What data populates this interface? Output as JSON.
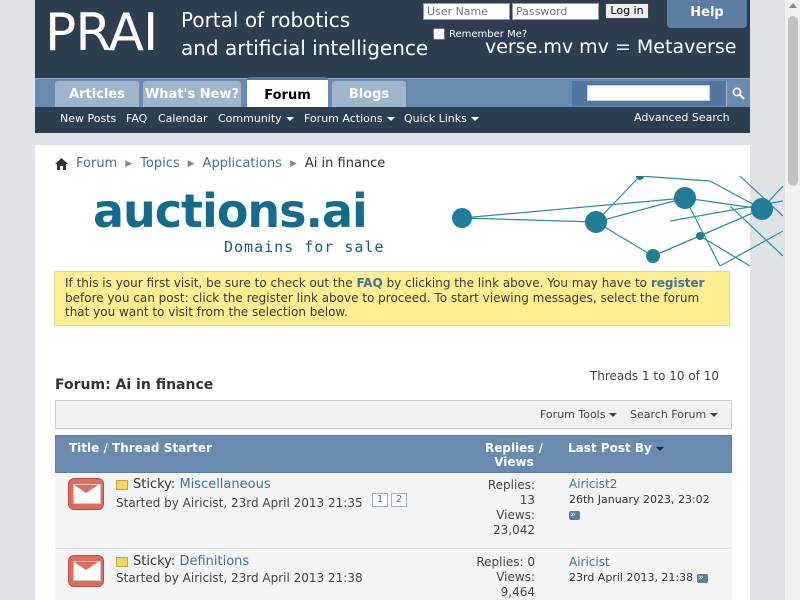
{
  "header": {
    "logo": "PRAI",
    "tagline_line1": "Portal of robotics",
    "tagline_line2": "and artificial intelligence",
    "verse": "verse.mv mv = Metaverse",
    "help": "Help"
  },
  "login": {
    "username_placeholder": "User Name",
    "password_placeholder": "Password",
    "button": "Log in",
    "remember": "Remember Me?"
  },
  "tabs": [
    {
      "label": "Articles"
    },
    {
      "label": "What's New?"
    },
    {
      "label": "Forum"
    },
    {
      "label": "Blogs"
    }
  ],
  "subnav": {
    "new_posts": "New Posts",
    "faq": "FAQ",
    "calendar": "Calendar",
    "community": "Community",
    "forum_actions": "Forum Actions",
    "quick_links": "Quick Links",
    "advanced_search": "Advanced Search"
  },
  "breadcrumb": [
    "Forum",
    "Topics",
    "Applications",
    "Ai in finance"
  ],
  "banner": {
    "title": "auctions.ai",
    "subtitle": "Domains for sale"
  },
  "notice": {
    "part1": "If this is your first visit, be sure to check out the ",
    "faq": "FAQ",
    "part2": " by clicking the link above. You may have to ",
    "register": "register",
    "part3": " before you can post: click the register link above to proceed. To start viewing messages, select the forum that you want to visit from the selection below."
  },
  "forum": {
    "title": "Forum: Ai in finance",
    "threads_count": "Threads 1 to 10 of 10",
    "tools": "Forum Tools",
    "search": "Search Forum"
  },
  "table_header": {
    "title": "Title",
    "sep": " / ",
    "starter": "Thread Starter",
    "replies": "Replies /",
    "views": "Views",
    "last_post": "Last Post By"
  },
  "threads": [
    {
      "prefix": "Sticky:",
      "title": "Miscellaneous",
      "starter": "Started by Airicist, 23rd April 2013 21:35",
      "pages": [
        "1",
        "2"
      ],
      "replies_label": "Replies:",
      "replies": "13",
      "views_label": "Views:",
      "views": "23,042",
      "last_by": "Airicist2",
      "last_date": "26th January 2023, 23:02"
    },
    {
      "prefix": "Sticky:",
      "title": "Definitions",
      "starter": "Started by Airicist, 23rd April 2013 21:38",
      "replies_label": "Replies:",
      "replies": "0",
      "views_label": "Views:",
      "views": "9,464",
      "last_by": "Airicist",
      "last_date": "23rd April 2013, 21:38"
    }
  ],
  "colors": {
    "header_bg": "#2d3e50",
    "nav_bg": "#6a8bb0",
    "link": "#417394",
    "notice_bg": "#fdee91",
    "banner_teal": "#146b8c"
  }
}
